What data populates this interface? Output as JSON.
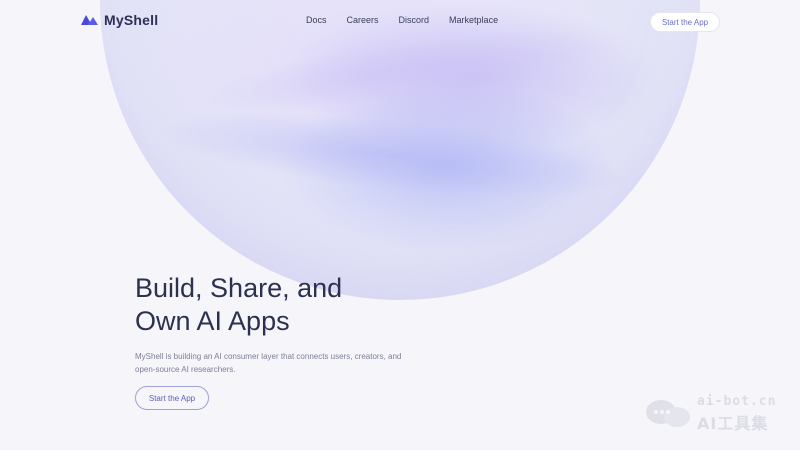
{
  "brand": {
    "name": "MyShell",
    "accent": "#5a5fb8",
    "title_color": "#2c3150",
    "background": "#f5f5fa"
  },
  "nav": {
    "links": [
      {
        "label": "Docs"
      },
      {
        "label": "Careers"
      },
      {
        "label": "Discord"
      },
      {
        "label": "Marketplace"
      }
    ],
    "cta_label": "Start the App"
  },
  "hero": {
    "title_line1": "Build, Share, and",
    "title_line2": "Own AI Apps",
    "subtitle": "MyShell is building an AI consumer layer that connects users, creators, and open-source AI researchers.",
    "cta_label": "Start the App"
  },
  "watermark": {
    "line1": "ai-bot.cn",
    "line2": "AI工具集",
    "icon": "chat-bubbles-icon"
  },
  "icons": {
    "logo": "myshell-logo-icon"
  }
}
